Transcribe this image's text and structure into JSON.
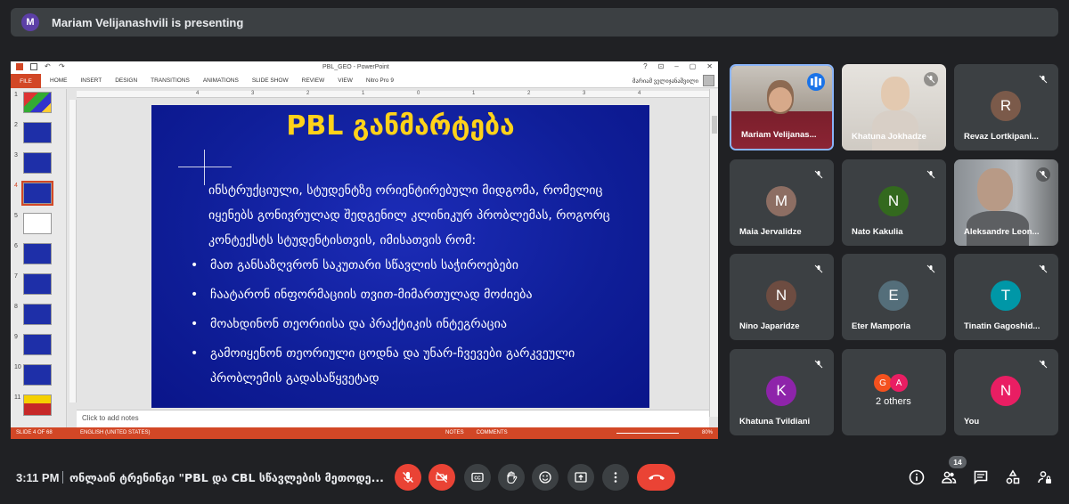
{
  "banner": {
    "avatar_letter": "M",
    "text": "Mariam Velijanashvili is presenting",
    "avatar_color": "#5c3fa6"
  },
  "powerpoint": {
    "window_title": "PBL_GEO - PowerPoint",
    "file_tab": "FILE",
    "tabs": [
      "HOME",
      "INSERT",
      "DESIGN",
      "TRANSITIONS",
      "ANIMATIONS",
      "SLIDE SHOW",
      "REVIEW",
      "VIEW",
      "Nitro Pro 9"
    ],
    "user": "მარიამ ველიჯანაშვილი",
    "window_controls": [
      "?",
      "⊡",
      "–",
      "▢",
      "✕"
    ],
    "thumbnails": [
      "1",
      "2",
      "3",
      "4",
      "5",
      "6",
      "7",
      "8",
      "9",
      "10",
      "11"
    ],
    "selected_slide": 4,
    "notes_placeholder": "Click to add notes",
    "status_left": "SLIDE 4 OF 68",
    "status_lang": "ENGLISH (UNITED STATES)",
    "status_notes": "NOTES",
    "status_comments": "COMMENTS",
    "zoom": "80%",
    "ruler_marks": [
      "4",
      "3",
      "2",
      "1",
      "0",
      "1",
      "2",
      "3",
      "4"
    ],
    "accent": "#d24726"
  },
  "slide": {
    "title": "PBL განმარტება",
    "intro": "ინსტრუქციული, სტუდენტზე ორიენტირებული მიდგომა, რომელიც იყენებს გონივრულად შედგენილ კლინიკურ პრობლემას, როგორც კონტექსტს სტუდენტისთვის, იმისათვის რომ:",
    "bullets": [
      "მათ განსაზღვრონ საკუთარი სწავლის საჭიროებები",
      "ჩაატარონ ინფორმაციის თვით-მიმართულად მოძიება",
      "მოახდინონ თეორიისა და პრაქტიკის ინტეგრაცია",
      "გამოიყენონ თეორიული ცოდნა და უნარ-ჩვევები გარკვეული პრობლემის გადასაწყვეტად"
    ],
    "title_color": "#ffd21a"
  },
  "participants": [
    {
      "name": "Mariam Velijanas...",
      "type": "video",
      "speaking": true
    },
    {
      "name": "Khatuna Jokhadze",
      "type": "video",
      "muted": true
    },
    {
      "name": "Revaz Lortkipani...",
      "letter": "R",
      "color": "#7b5a4a",
      "muted": true
    },
    {
      "name": "Maia Jervalidze",
      "letter": "M",
      "color": "#8d6e63",
      "muted": true
    },
    {
      "name": "Nato Kakulia",
      "letter": "N",
      "color": "#33691e",
      "muted": true
    },
    {
      "name": "Aleksandre Leon...",
      "type": "video",
      "muted": true
    },
    {
      "name": "Nino Japaridze",
      "letter": "N",
      "color": "#6d4c41",
      "muted": true
    },
    {
      "name": "Eter Mamporia",
      "letter": "E",
      "color": "#546e7a",
      "muted": true
    },
    {
      "name": "Tinatin Gagoshid...",
      "letter": "T",
      "color": "#0097a7",
      "muted": true
    },
    {
      "name": "Khatuna Tvildiani",
      "letter": "K",
      "color": "#8e24aa",
      "muted": true
    },
    {
      "name": "2 others",
      "others": [
        {
          "letter": "G",
          "color": "#f4511e"
        },
        {
          "letter": "A",
          "color": "#e91e63"
        }
      ]
    },
    {
      "name": "You",
      "letter": "N",
      "color": "#e91e63",
      "muted": true
    }
  ],
  "bottom": {
    "time": "3:11 PM",
    "meeting_title": "ონლაინ ტრენინგი \"PBL და CBL სწავლების მეთოდე...",
    "people_count": "14"
  }
}
